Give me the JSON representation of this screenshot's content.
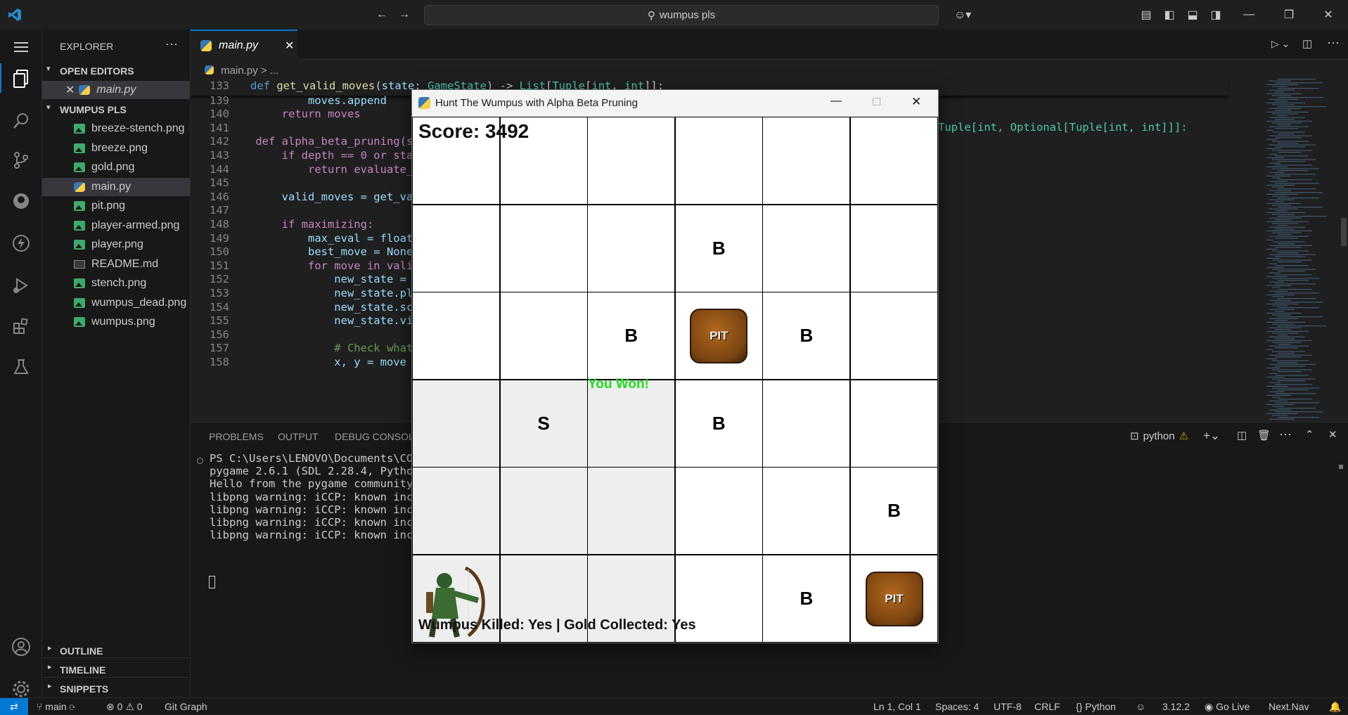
{
  "titlebar": {
    "search": "wumpus pls"
  },
  "sidebar": {
    "title": "EXPLORER",
    "open_editors": "OPEN EDITORS",
    "open_file": "main.py",
    "folder": "WUMPUS PLS",
    "files": [
      {
        "name": "breeze-stench.png",
        "type": "img"
      },
      {
        "name": "breeze.png",
        "type": "img"
      },
      {
        "name": "gold.png",
        "type": "img"
      },
      {
        "name": "main.py",
        "type": "py"
      },
      {
        "name": "pit.png",
        "type": "img"
      },
      {
        "name": "player-armed.png",
        "type": "img"
      },
      {
        "name": "player.png",
        "type": "img"
      },
      {
        "name": "README.md",
        "type": "md"
      },
      {
        "name": "stench.png",
        "type": "img"
      },
      {
        "name": "wumpus_dead.png",
        "type": "img"
      },
      {
        "name": "wumpus.png",
        "type": "img"
      }
    ],
    "outline": "OUTLINE",
    "timeline": "TIMELINE",
    "snippets": "SNIPPETS"
  },
  "editor": {
    "tab": "main.py",
    "breadcrumb_file": "main.py",
    "breadcrumb_sep": ">",
    "breadcrumb_more": "...",
    "sticky_line": "133",
    "sticky_code": "def get_valid_moves(state: GameState) -> List[Tuple[int, int]]:",
    "lines": [
      {
        "n": "139",
        "code": "            moves.append"
      },
      {
        "n": "140",
        "code": "        return moves"
      },
      {
        "n": "141",
        "code": ""
      },
      {
        "n": "142",
        "code": "    def alpha_beta_pruning(s"
      },
      {
        "n": "143",
        "code": "        if depth == 0 or sta"
      },
      {
        "n": "144",
        "code": "            return evaluate_"
      },
      {
        "n": "145",
        "code": ""
      },
      {
        "n": "146",
        "code": "        valid_moves = get_va"
      },
      {
        "n": "147",
        "code": ""
      },
      {
        "n": "148",
        "code": "        if maximizing:"
      },
      {
        "n": "149",
        "code": "            max_eval = float"
      },
      {
        "n": "150",
        "code": "            best_move = None"
      },
      {
        "n": "151",
        "code": "            for move in vali"
      },
      {
        "n": "152",
        "code": "                new_state = "
      },
      {
        "n": "153",
        "code": "                new_state.pl"
      },
      {
        "n": "154",
        "code": "                new_state.sc"
      },
      {
        "n": "155",
        "code": "                new_state.vi"
      },
      {
        "n": "156",
        "code": ""
      },
      {
        "n": "157",
        "code": "                # Check what"
      },
      {
        "n": "158",
        "code": "                x, y = move"
      }
    ],
    "line142_tail": "Tuple[int, Optional[Tuple[int, int]]]:"
  },
  "panel": {
    "tabs": [
      "PROBLEMS",
      "OUTPUT",
      "DEBUG CONSOLE"
    ],
    "terminal_name": "python",
    "lines": [
      "PS C:\\Users\\LENOVO\\Documents\\COL",
      "pygame 2.6.1 (SDL 2.28.4, Python",
      "Hello from the pygame community.",
      "libpng warning: iCCP: known inco",
      "libpng warning: iCCP: known inco",
      "libpng warning: iCCP: known inco",
      "libpng warning: iCCP: known inco"
    ]
  },
  "status": {
    "branch": "main",
    "problems": "0",
    "warnings": "0",
    "git_graph": "Git Graph",
    "position": "Ln 1, Col 1",
    "spaces": "Spaces: 4",
    "encoding": "UTF-8",
    "eol": "CRLF",
    "language": "Python",
    "version": "3.12.2",
    "golive": "Go Live",
    "nextnav": "Next.Nav"
  },
  "game": {
    "window_title": "Hunt The Wumpus with Alpha Beta Pruning",
    "score": "Score: 3492",
    "won": "You Won!",
    "footer": "Wumpus Killed: Yes | Gold Collected: Yes",
    "pit_label": "PIT",
    "grid": [
      [
        "",
        "",
        "",
        "",
        "",
        ""
      ],
      [
        "",
        "",
        "",
        "B",
        "",
        ""
      ],
      [
        "",
        "",
        "B",
        "PIT",
        "B",
        ""
      ],
      [
        "",
        "S",
        "",
        "B",
        "",
        ""
      ],
      [
        "",
        "",
        "",
        "",
        "",
        "B"
      ],
      [
        "PLAYER",
        "",
        "",
        "",
        "B",
        "PIT"
      ]
    ],
    "visited": [
      [
        3,
        0
      ],
      [
        3,
        1
      ],
      [
        3,
        2
      ],
      [
        4,
        0
      ],
      [
        4,
        1
      ],
      [
        4,
        2
      ],
      [
        5,
        0
      ],
      [
        5,
        1
      ],
      [
        5,
        2
      ]
    ]
  }
}
